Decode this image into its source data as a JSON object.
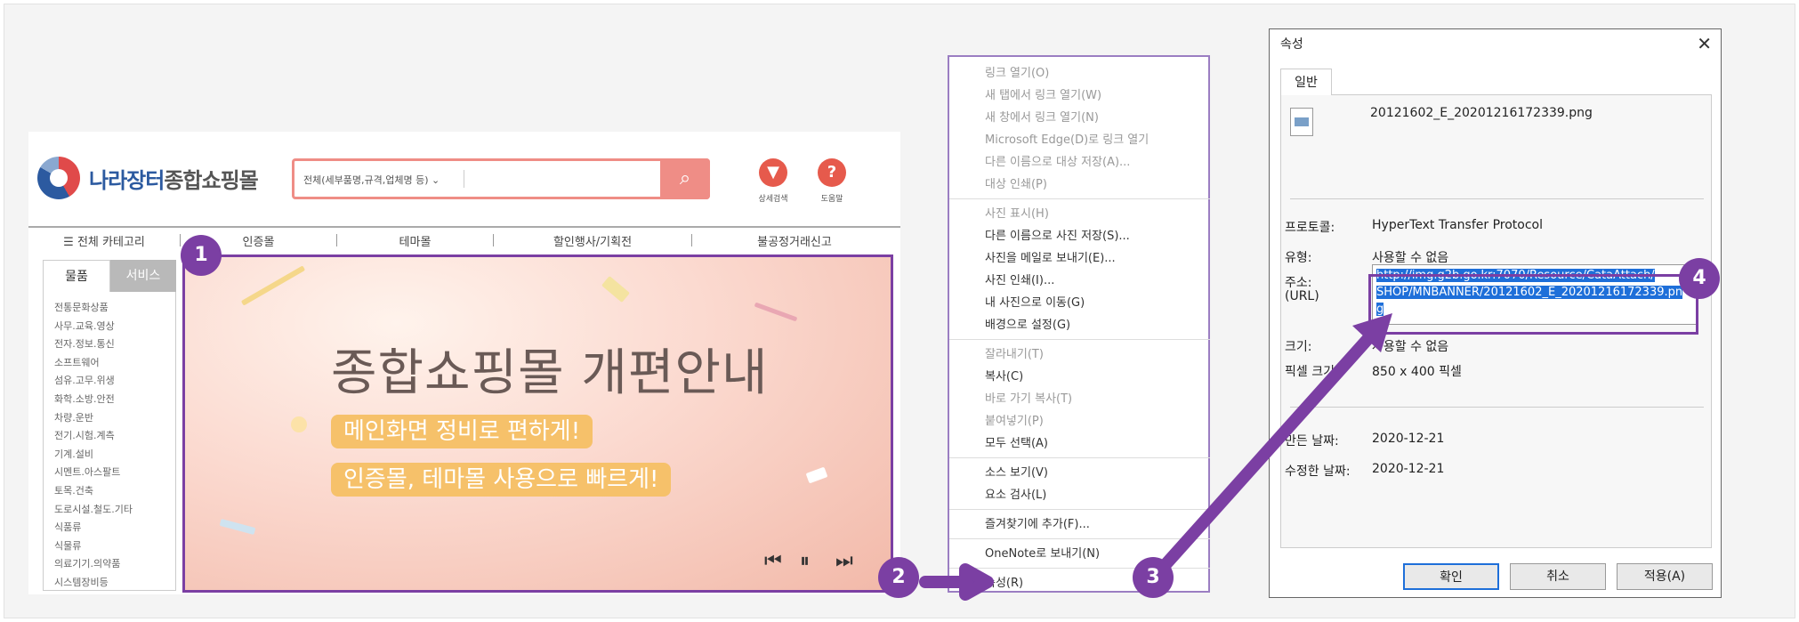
{
  "site": {
    "logo": {
      "part1": "나라장터",
      "part2": "종합쇼핑몰"
    },
    "search": {
      "category": "전체(세부품명,규격,업체명 등)",
      "chevron": "⌄",
      "button_icon": "⌕"
    },
    "top_icons": [
      {
        "glyph": "▼",
        "label": "상세검색",
        "color": "#e65a4c"
      },
      {
        "glyph": "?",
        "label": "도움말",
        "color": "#e65a4c"
      }
    ],
    "nav": {
      "menu_icon": "☰",
      "all_categories": "전체 카테고리",
      "items": [
        "인증몰",
        "테마몰",
        "할인행사/기획전",
        "불공정거래신고"
      ]
    },
    "tabs": [
      "물품",
      "서비스"
    ],
    "categories": [
      "전통문화상품",
      "사무.교육.영상",
      "전자.정보.통신",
      "소프트웨어",
      "섬유.고무.위생",
      "화학.소방.안전",
      "차량.운반",
      "전기.시험.계측",
      "기계.설비",
      "시멘트.아스팔트",
      "토목.건축",
      "도로시설.철도.기타",
      "식품류",
      "식물류",
      "의료기기.의약품",
      "시스템장비등"
    ],
    "banner": {
      "title": "종합쇼핑몰 개편안내",
      "line1": "메인화면 정비로 편하게!",
      "line2": "인증몰, 테마몰 사용으로 빠르게!",
      "controls": {
        "prev": "⏮",
        "pause": "⏸",
        "next": "⏭"
      }
    }
  },
  "steps": [
    "1",
    "2",
    "3",
    "4"
  ],
  "context_menu": {
    "groups": [
      [
        {
          "label": "링크 열기(O)",
          "dim": true
        },
        {
          "label": "새 탭에서 링크 열기(W)",
          "dim": true
        },
        {
          "label": "새 창에서 링크 열기(N)",
          "dim": true
        },
        {
          "label": "Microsoft Edge(D)로 링크 열기",
          "dim": true
        },
        {
          "label": "다른 이름으로 대상 저장(A)...",
          "dim": true
        },
        {
          "label": "대상 인쇄(P)",
          "dim": true
        }
      ],
      [
        {
          "label": "사진 표시(H)",
          "dim": true
        },
        {
          "label": "다른 이름으로 사진 저장(S)...",
          "dim": false
        },
        {
          "label": "사진을 메일로 보내기(E)...",
          "dim": false
        },
        {
          "label": "사진 인쇄(I)...",
          "dim": false
        },
        {
          "label": "내 사진으로 이동(G)",
          "dim": false
        },
        {
          "label": "배경으로 설정(G)",
          "dim": false
        }
      ],
      [
        {
          "label": "잘라내기(T)",
          "dim": true
        },
        {
          "label": "복사(C)",
          "dim": false
        },
        {
          "label": "바로 가기 복사(T)",
          "dim": true
        },
        {
          "label": "붙여넣기(P)",
          "dim": true
        },
        {
          "label": "모두 선택(A)",
          "dim": false
        }
      ],
      [
        {
          "label": "소스 보기(V)",
          "dim": false
        },
        {
          "label": "요소 검사(L)",
          "dim": false
        }
      ],
      [
        {
          "label": "즐겨찾기에 추가(F)...",
          "dim": false
        }
      ],
      [
        {
          "label": "OneNote로 보내기(N)",
          "dim": false
        }
      ],
      [
        {
          "label": "속성(R)",
          "dim": false
        }
      ]
    ]
  },
  "dialog": {
    "title": "속성",
    "close": "✕",
    "tab": "일반",
    "file_name": "20121602_E_20201216172339.png",
    "protocol_label": "프로토콜:",
    "protocol_value": "HyperText Transfer Protocol",
    "type_label": "유형:",
    "type_value": "사용할 수 없음",
    "address_label": "주소:",
    "url_label": "(URL)",
    "address_lines": [
      "http://img.g2b.go.kr:7070/Resource/CataAttach/",
      "SHOP/MNBANNER/20121602_E_20201216172339.pn",
      "g"
    ],
    "size_label": "크기:",
    "size_value": "사용할 수 없음",
    "pixel_label": "픽셀 크기:",
    "pixel_value": "850 x 400 픽셀",
    "created_label": "만든 날짜:",
    "created_value": "2020-12-21",
    "modified_label": "수정한 날짜:",
    "modified_value": "2020-12-21",
    "buttons": {
      "ok": "확인",
      "cancel": "취소",
      "apply": "적용(A)"
    }
  }
}
